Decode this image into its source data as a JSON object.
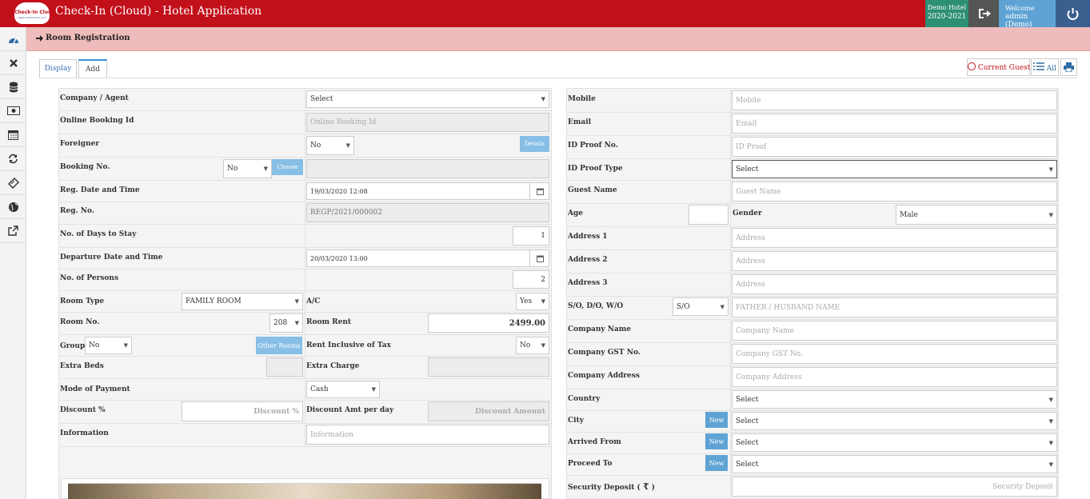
{
  "app": {
    "title": "Check-In (Cloud) - Hotel Application",
    "logo_text": "Check-In Cloud",
    "logo_sub": "www.checkincloud.com",
    "hotel_name": "Demo Hotel",
    "fiscal_year": "2020-2021",
    "welcome": "Welcome",
    "user": "admin (Demo)"
  },
  "breadcrumb": "Room Registration",
  "tabs": [
    "Display",
    "Add"
  ],
  "toolbar": {
    "current_guest": "Current Guest",
    "all": "All"
  },
  "left_form": {
    "company_agent": {
      "label": "Company / Agent",
      "value": "Select"
    },
    "online_booking": {
      "label": "Online Booking Id",
      "placeholder": "Online Booking Id"
    },
    "foreigner": {
      "label": "Foreigner",
      "value": "No",
      "button": "Details"
    },
    "booking_no": {
      "label": "Booking No.",
      "value": "No",
      "button": "Choose"
    },
    "reg_date": {
      "label": "Reg. Date and Time",
      "value": "19/03/2020 12:08"
    },
    "reg_no": {
      "label": "Reg. No.",
      "value": "REGP/2021/000002"
    },
    "days_to_stay": {
      "label": "No. of Days to Stay",
      "value": "1"
    },
    "departure": {
      "label": "Departure Date and Time",
      "value": "20/03/2020 13:00"
    },
    "persons": {
      "label": "No. of Persons",
      "value": "2"
    },
    "room_type": {
      "label": "Room Type",
      "value": "FAMILY ROOM"
    },
    "ac": {
      "label": "A/C",
      "value": "Yes"
    },
    "room_no": {
      "label": "Room No.",
      "value": "208"
    },
    "room_rent": {
      "label": "Room Rent",
      "value": "2499.00"
    },
    "group": {
      "label": "Group",
      "value": "No",
      "button": "Other Rooms"
    },
    "rent_incl_tax": {
      "label": "Rent Inclusive of Tax",
      "value": "No"
    },
    "extra_beds": {
      "label": "Extra Beds"
    },
    "extra_charge": {
      "label": "Extra Charge"
    },
    "payment_mode": {
      "label": "Mode of Payment",
      "value": "Cash"
    },
    "discount_pct": {
      "label": "Discount %",
      "placeholder": "Discount %"
    },
    "discount_amt": {
      "label": "Discount Amt per day",
      "placeholder": "Discount Amount"
    },
    "information": {
      "label": "Information",
      "placeholder": "Information"
    }
  },
  "right_form": {
    "mobile": {
      "label": "Mobile",
      "placeholder": "Mobile"
    },
    "email": {
      "label": "Email",
      "placeholder": "Email"
    },
    "id_proof_no": {
      "label": "ID Proof No.",
      "placeholder": "ID Proof"
    },
    "id_proof_type": {
      "label": "ID Proof Type",
      "value": "Select"
    },
    "guest_name": {
      "label": "Guest Name",
      "placeholder": "Guest Name"
    },
    "age": {
      "label": "Age"
    },
    "gender": {
      "label": "Gender",
      "value": "Male"
    },
    "address1": {
      "label": "Address 1",
      "placeholder": "Address"
    },
    "address2": {
      "label": "Address 2",
      "placeholder": "Address"
    },
    "address3": {
      "label": "Address 3",
      "placeholder": "Address"
    },
    "relation": {
      "label": "S/O, D/O, W/O",
      "value": "S/O",
      "placeholder": "FATHER / HUSBAND NAME"
    },
    "company_name": {
      "label": "Company Name",
      "placeholder": "Company Name"
    },
    "company_gst": {
      "label": "Company GST No.",
      "placeholder": "Company GST No."
    },
    "company_address": {
      "label": "Company Address",
      "placeholder": "Company Address"
    },
    "country": {
      "label": "Country",
      "value": "Select"
    },
    "city": {
      "label": "City",
      "value": "Select",
      "button": "New"
    },
    "arrived_from": {
      "label": "Arrived From",
      "value": "Select",
      "button": "New"
    },
    "proceed_to": {
      "label": "Proceed To",
      "value": "Select",
      "button": "New"
    },
    "security_deposit": {
      "label": "Security Deposit (",
      "currency": "₹",
      "close": ")",
      "placeholder": "Security Deposit"
    }
  },
  "icons": [
    "dashboard-icon",
    "close-icon",
    "database-icon",
    "money-icon",
    "calendar-icon",
    "refresh-icon",
    "ticket-icon",
    "globe-icon",
    "external-link-icon"
  ]
}
